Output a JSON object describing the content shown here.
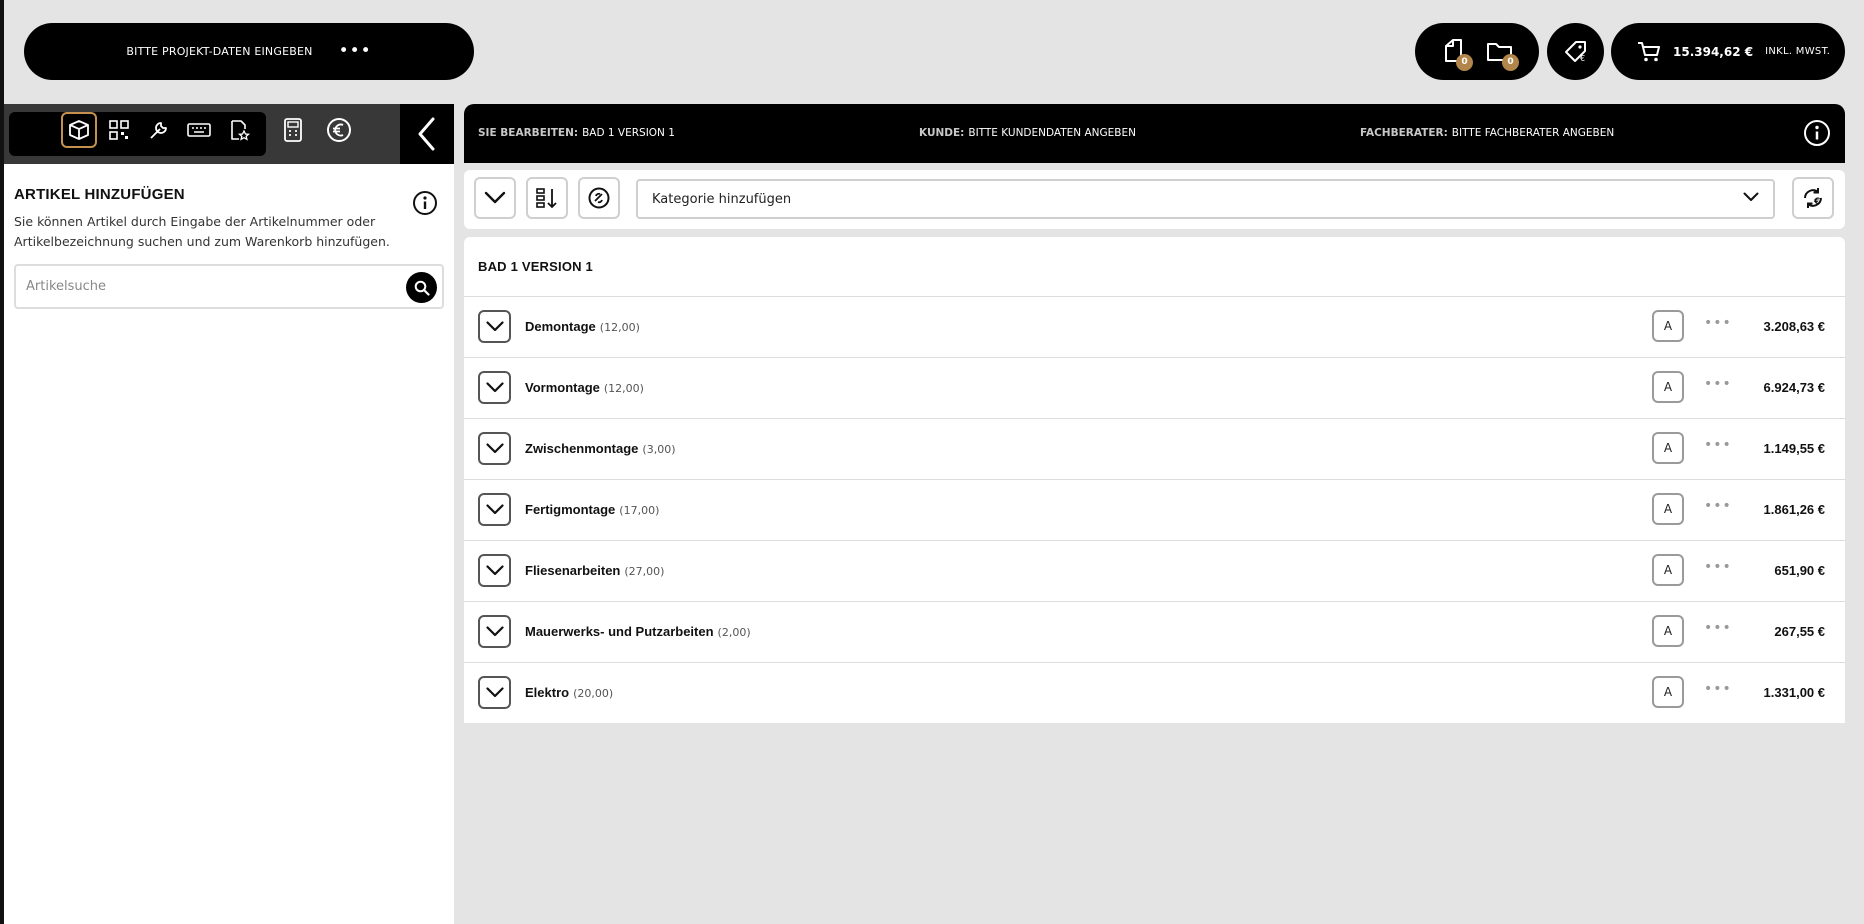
{
  "header": {
    "project_label": "BITTE PROJEKT-DATEN EINGEBEN",
    "more_label": "•••",
    "documents_count": "0",
    "folders_count": "0",
    "cart_total": "15.394,62 €",
    "cart_vat_note": "INKL. MWST."
  },
  "sidebar": {
    "title": "ARTIKEL HINZUFÜGEN",
    "description": "Sie können Artikel durch Eingabe der Artikelnummer oder Artikelbezeichnung suchen und zum Warenkorb hinzufügen.",
    "search_placeholder": "Artikelsuche",
    "tools": [
      "cart-icon",
      "box-icon",
      "qr-code-icon",
      "wrench-icon",
      "keyboard-icon",
      "document-star-icon",
      "calculator-icon",
      "euro-icon"
    ]
  },
  "info_bar": {
    "editing_key": "SIE BEARBEITEN:",
    "editing_value": "BAD 1 VERSION 1",
    "customer_key": "KUNDE:",
    "customer_value": "BITTE KUNDENDATEN ANGEBEN",
    "advisor_key": "FACHBERATER:",
    "advisor_value": "BITTE FACHBERATER ANGEBEN"
  },
  "toolbar": {
    "category_select": "Kategorie hinzufügen"
  },
  "main": {
    "title": "BAD 1 VERSION 1",
    "rows": [
      {
        "name": "Demontage",
        "qty": "(12,00)",
        "a": "A",
        "dots": "•••",
        "price": "3.208,63 €"
      },
      {
        "name": "Vormontage",
        "qty": "(12,00)",
        "a": "A",
        "dots": "•••",
        "price": "6.924,73 €"
      },
      {
        "name": "Zwischenmontage",
        "qty": "(3,00)",
        "a": "A",
        "dots": "•••",
        "price": "1.149,55 €"
      },
      {
        "name": "Fertigmontage",
        "qty": "(17,00)",
        "a": "A",
        "dots": "•••",
        "price": "1.861,26 €"
      },
      {
        "name": "Fliesenarbeiten",
        "qty": "(27,00)",
        "a": "A",
        "dots": "•••",
        "price": "651,90 €"
      },
      {
        "name": "Mauerwerks- und Putzarbeiten",
        "qty": "(2,00)",
        "a": "A",
        "dots": "•••",
        "price": "267,55 €"
      },
      {
        "name": "Elektro",
        "qty": "(20,00)",
        "a": "A",
        "dots": "•••",
        "price": "1.331,00 €"
      }
    ]
  },
  "colors": {
    "accent_gold": "#b2864a",
    "background": "#e4e4e4",
    "bar_black": "#000000"
  }
}
